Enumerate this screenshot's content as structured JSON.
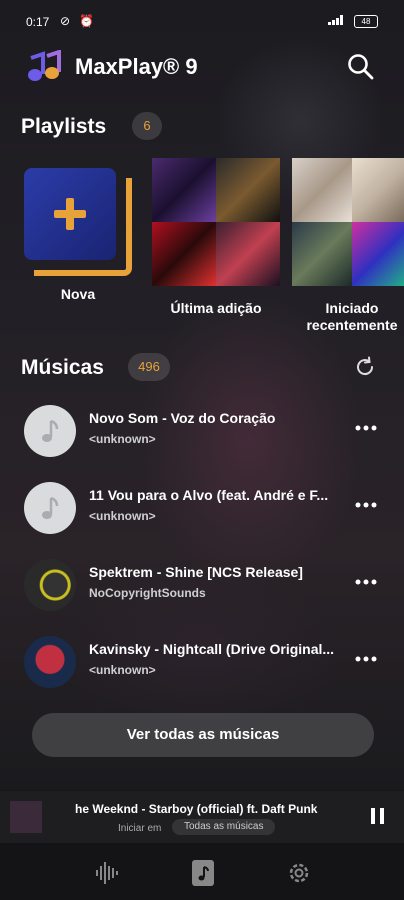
{
  "status_bar": {
    "time": "0:17",
    "left_icons": "⊘ ⏰",
    "battery": "48"
  },
  "header": {
    "app_name": "MaxPlay® 9"
  },
  "playlists": {
    "title": "Playlists",
    "count": "6",
    "items": [
      {
        "label": "Nova"
      },
      {
        "label": "Última adição"
      },
      {
        "label": "Iniciado recentemente"
      }
    ]
  },
  "songs": {
    "title": "Músicas",
    "count": "496",
    "items": [
      {
        "title": "Novo Som - Voz do Coração",
        "artist": "<unknown>"
      },
      {
        "title": "11 Vou para o Alvo (feat. André e F...",
        "artist": "<unknown>"
      },
      {
        "title": "Spektrem - Shine [NCS Release]",
        "artist": "NoCopyrightSounds"
      },
      {
        "title": "Kavinsky - Nightcall (Drive Original...",
        "artist": "<unknown>"
      }
    ],
    "view_all_label": "Ver todas as músicas"
  },
  "now_playing": {
    "title": "he Weeknd - Starboy (official) ft. Daft Punk",
    "started_in": "Iniciar em",
    "source": "Todas as músicas"
  },
  "colors": {
    "accent": "#e8a23a",
    "primary_blue": "#2b3ca8"
  },
  "icons": {
    "search": "search-icon",
    "refresh": "refresh-icon",
    "more": "more-icon",
    "pause": "pause-icon",
    "nav": [
      "waveform-icon",
      "music-library-icon",
      "settings-icon"
    ]
  }
}
